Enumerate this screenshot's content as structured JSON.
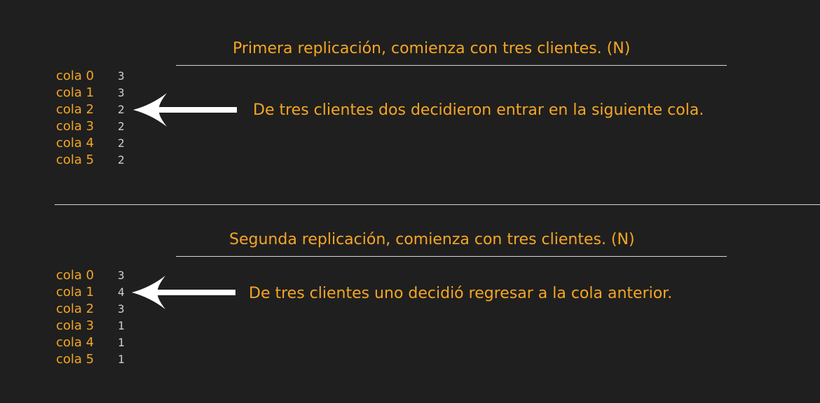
{
  "colors": {
    "background": "#1f1f1f",
    "accent": "#f5a623",
    "value_text": "#d0d0d0",
    "rule": "#d6d6d6",
    "arrow": "#ffffff"
  },
  "first": {
    "title": "Primera replicación, comienza con tres clientes. (N)",
    "rows": [
      {
        "label": "cola 0",
        "value": "3"
      },
      {
        "label": "cola 1",
        "value": "3"
      },
      {
        "label": "cola 2",
        "value": "2"
      },
      {
        "label": "cola 3",
        "value": "2"
      },
      {
        "label": "cola 4",
        "value": "2"
      },
      {
        "label": "cola 5",
        "value": "2"
      }
    ],
    "note": "De tres clientes dos decidieron entrar en la siguiente cola.",
    "arrow_icon": "left-arrow-icon"
  },
  "second": {
    "title": "Segunda replicación, comienza con tres clientes. (N)",
    "rows": [
      {
        "label": "cola 0",
        "value": "3"
      },
      {
        "label": "cola 1",
        "value": "4"
      },
      {
        "label": "cola 2",
        "value": "3"
      },
      {
        "label": "cola 3",
        "value": "1"
      },
      {
        "label": "cola 4",
        "value": "1"
      },
      {
        "label": "cola 5",
        "value": "1"
      }
    ],
    "note": "De tres clientes uno decidió regresar a la cola anterior.",
    "arrow_icon": "left-arrow-icon"
  }
}
